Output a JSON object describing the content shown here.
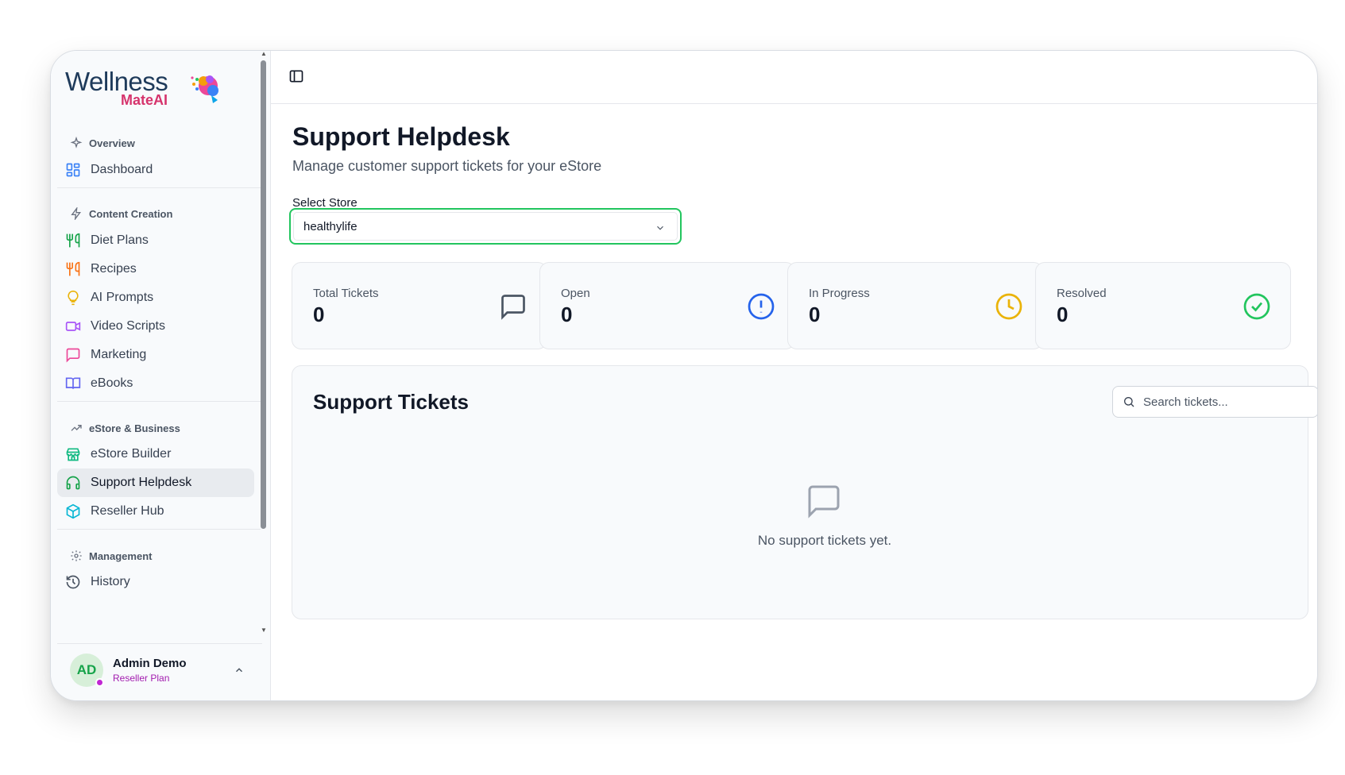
{
  "app": {
    "logo_word1": "Wellness",
    "logo_word2": "MateAI"
  },
  "sidebar": {
    "sections": [
      {
        "label": "Overview",
        "icon": "sparkle-icon"
      },
      {
        "label": "Content Creation",
        "icon": "lightning-icon"
      },
      {
        "label": "eStore & Business",
        "icon": "trending-up-icon"
      },
      {
        "label": "Management",
        "icon": "gear-icon"
      }
    ],
    "items": [
      {
        "label": "Dashboard",
        "icon": "grid-icon",
        "color": "#3b82f6"
      },
      {
        "label": "Diet Plans",
        "icon": "utensils-icon",
        "color": "#16a34a"
      },
      {
        "label": "Recipes",
        "icon": "utensils-icon",
        "color": "#f97316"
      },
      {
        "label": "AI Prompts",
        "icon": "lightbulb-icon",
        "color": "#eab308"
      },
      {
        "label": "Video Scripts",
        "icon": "video-icon",
        "color": "#a855f7"
      },
      {
        "label": "Marketing",
        "icon": "message-icon",
        "color": "#ec4899"
      },
      {
        "label": "eBooks",
        "icon": "book-icon",
        "color": "#6366f1"
      },
      {
        "label": "eStore Builder",
        "icon": "store-icon",
        "color": "#10b981"
      },
      {
        "label": "Support Helpdesk",
        "icon": "headset-icon",
        "color": "#16a34a",
        "active": true
      },
      {
        "label": "Reseller Hub",
        "icon": "package-icon",
        "color": "#06b6d4"
      },
      {
        "label": "History",
        "icon": "history-icon",
        "color": "#4b5563"
      }
    ],
    "user": {
      "initials": "AD",
      "name": "Admin Demo",
      "plan": "Reseller Plan"
    }
  },
  "main": {
    "title": "Support Helpdesk",
    "subtitle": "Manage customer support tickets for your eStore",
    "select_label": "Select Store",
    "selected_store": "healthylife",
    "stats": [
      {
        "label": "Total Tickets",
        "value": "0",
        "icon": "message-square-icon",
        "color": "#4b5563"
      },
      {
        "label": "Open",
        "value": "0",
        "icon": "alert-circle-icon",
        "color": "#2563eb"
      },
      {
        "label": "In Progress",
        "value": "0",
        "icon": "clock-icon",
        "color": "#eab308"
      },
      {
        "label": "Resolved",
        "value": "0",
        "icon": "check-circle-icon",
        "color": "#22c55e"
      }
    ],
    "tickets": {
      "title": "Support Tickets",
      "search_placeholder": "Search tickets...",
      "empty_text": "No support tickets yet."
    }
  }
}
